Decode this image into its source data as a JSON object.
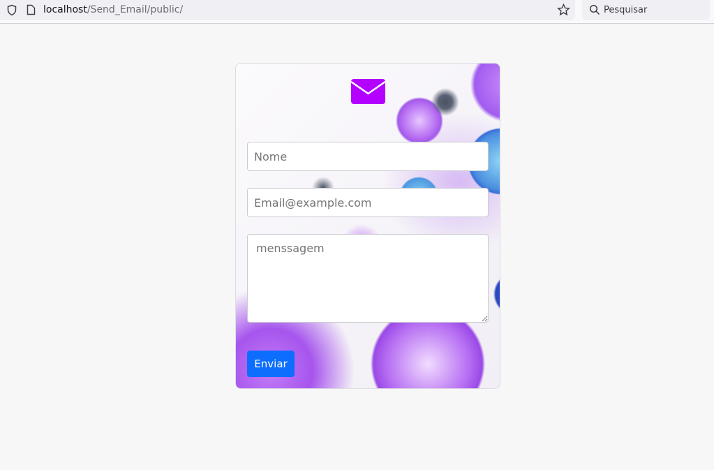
{
  "browser": {
    "url_host": "localhost",
    "url_path": "/Send_Email/public/",
    "search_placeholder": "Pesquisar"
  },
  "form": {
    "name_placeholder": "Nome",
    "email_placeholder": "Email@example.com",
    "message_placeholder": "menssagem",
    "submit_label": "Enviar"
  },
  "colors": {
    "icon": "#b300ff",
    "button": "#0d6efd"
  }
}
